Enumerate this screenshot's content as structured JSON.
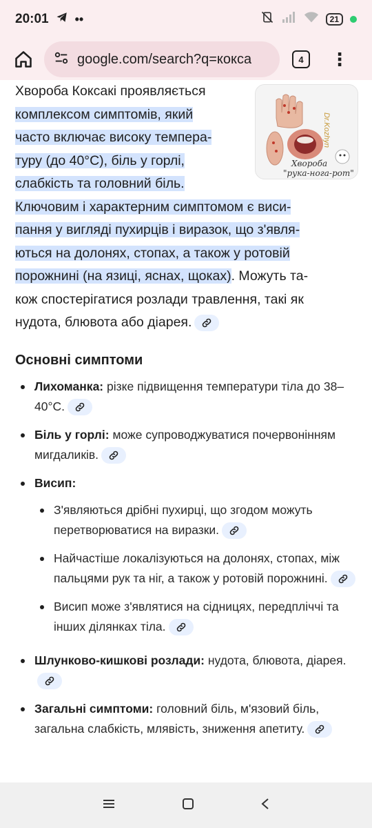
{
  "status_bar": {
    "time": "20:01",
    "battery": "21",
    "icons": [
      "telegram-icon",
      "more-dots-icon",
      "mute-icon",
      "signal-icon",
      "wifi-icon",
      "battery-icon"
    ]
  },
  "browser": {
    "url": "google.com/search?q=кокса",
    "tab_count": "4"
  },
  "intro": {
    "line1": "Хвороба Коксакі проявляється",
    "hl_lines": [
      "комплексом симптомів, який",
      "часто включає високу темпера-",
      "туру (до 40°C), біль у горлі,",
      "слабкість та головний біль."
    ],
    "hl_lines2": [
      "Ключовим і характерним симптомом є виси-",
      "пання у вигляді пухирців і виразок, що з'явля-",
      "ються на долонях, стопах, а також у ротовій"
    ],
    "hl_last": "порожнині (на язиці, яснах, щоках)",
    "tail1": ". Можуть та-",
    "tail2": "кож спостерігатися розлади травлення, такі як",
    "tail3": "нудота, блювота або діарея."
  },
  "image": {
    "caption1": "Хвороба",
    "caption2": "\"рука-нога-рот\"",
    "watermark": "Dr.Kozhyn"
  },
  "section": {
    "title": "Основні симптоми",
    "items": [
      {
        "bold": "Лихоманка:",
        "text": " різке підвищення температури тіла до 38–40°C."
      },
      {
        "bold": "Біль у горлі:",
        "text": " може супроводжуватися почервонінням мигдаликів."
      },
      {
        "bold": "Висип:",
        "text": ""
      },
      {
        "bold": "Шлунково-кишкові розлади:",
        "text": " нудота, блювота, діарея."
      },
      {
        "bold": "Загальні симптоми:",
        "text": " головний біль, м'язовий біль, загальна слабкість, млявість, зниження апетиту."
      }
    ],
    "rash_sub": [
      "З'являються дрібні пухирці, що згодом можуть перетворюватися на виразки.",
      "Найчастіше локалізуються на долонях, стопах, між пальцями рук та ніг, а також у ротовій порожнині.",
      "Висип може з'являтися на сідницях, передпліччі та інших ділянках тіла."
    ]
  }
}
